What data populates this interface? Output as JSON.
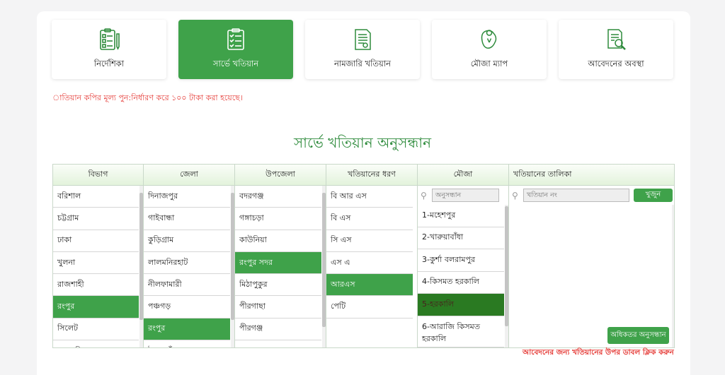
{
  "tiles": [
    {
      "label": "নির্দেশিকা",
      "icon": "clipboard-checklist-icon"
    },
    {
      "label": "সার্ভে খতিয়ান",
      "icon": "clipboard-survey-icon"
    },
    {
      "label": "নামজারি খতিয়ান",
      "icon": "document-certificate-icon"
    },
    {
      "label": "মৌজা ম্যাপ",
      "icon": "map-pin-icon"
    },
    {
      "label": "আবেদনের অবস্থা",
      "icon": "document-search-icon"
    }
  ],
  "notice": "াতিয়ান কপির মূল্য পুন:নির্ধারণ করে ১০০ টাকা করা হয়েছে।",
  "heading": "সার্ভে খতিয়ান অনুসন্ধান",
  "columns": {
    "division": {
      "header": "বিভাগ",
      "items": [
        "বরিশাল",
        "চট্টগ্রাম",
        "ঢাকা",
        "খুলনা",
        "রাজশাহী",
        "রংপুর",
        "সিলেট",
        "ময়মনসিংহ"
      ],
      "selected": "রংপুর"
    },
    "district": {
      "header": "জেলা",
      "items": [
        "দিনাজপুর",
        "গাইবান্ধা",
        "কুড়িগ্রাম",
        "লালমনিরহাট",
        "নীলফামারী",
        "পঞ্চগড়",
        "রংপুর",
        "ঠাকুরগাঁও"
      ],
      "selected": "রংপুর"
    },
    "upazila": {
      "header": "উপজেলা",
      "items": [
        "বদরগঞ্জ",
        "গঙ্গাচড়া",
        "কাউনিয়া",
        "রংপুর সদর",
        "মিঠাপুকুর",
        "পীরগাছা",
        "পীরগঞ্জ"
      ],
      "selected": "রংপুর সদর"
    },
    "khatian_type": {
      "header": "খতিয়ানের ধরণ",
      "items": [
        "বি আর এস",
        "বি এস",
        "সি এস",
        "এস এ",
        "আরএস",
        "পেটি"
      ],
      "selected": "আরএস"
    },
    "mouza": {
      "header": "মৌজা",
      "search_placeholder": "অনুসন্ধান",
      "items": [
        "1-মহেশপুর",
        "2-খারুয়াবাঁধা",
        "3-কুর্শা বলরামপুর",
        "4-কিসমত হরকালি",
        "5-হরকালি",
        "6-আরাজি কিসমত হরকালি"
      ],
      "selected": "5-হরকালি"
    },
    "khatian_list": {
      "header": "খতিয়ানের তালিকা",
      "search_placeholder": "খতিয়ান নং",
      "search_button": "খুজুন",
      "more_button": "অধিকতর অনুসন্ধান"
    }
  },
  "footnote": "আবেদনের জন্য খতিয়ানের উপর ডাবল ক্লিক করুন",
  "colors": {
    "accent": "#3fa24a",
    "accent_dark": "#2a7a22",
    "heading": "#2e8b3c",
    "alert": "#e53935"
  }
}
